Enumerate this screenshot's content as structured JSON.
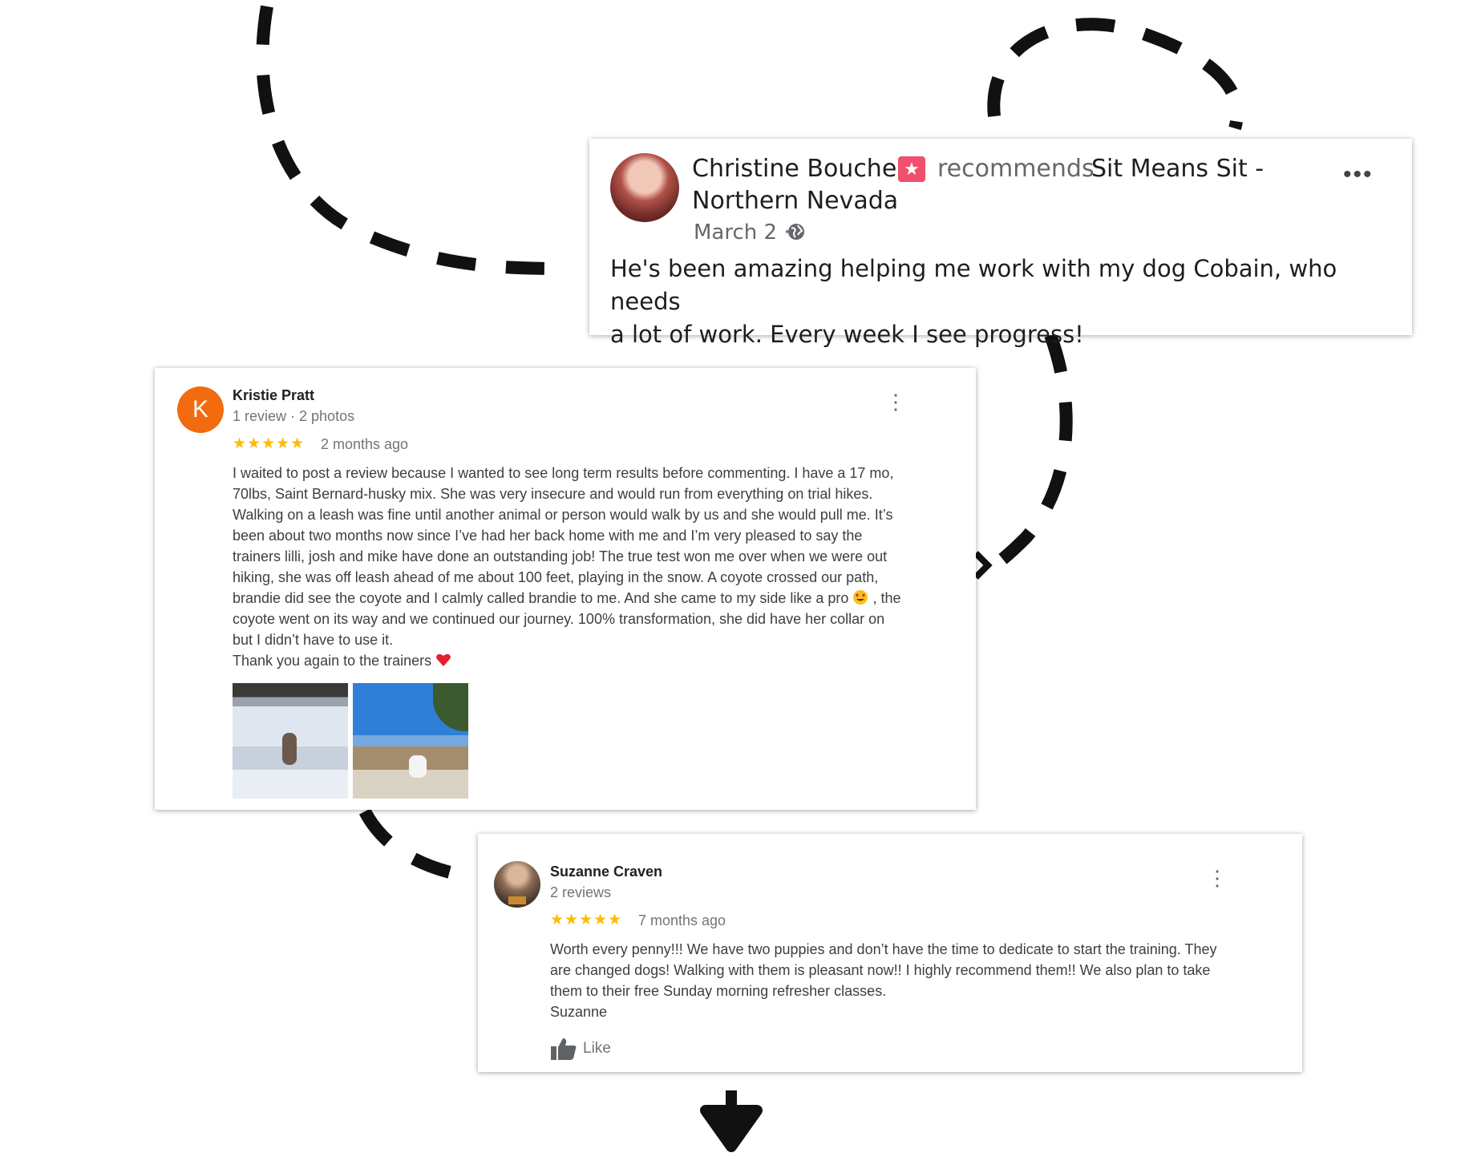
{
  "facebook_post": {
    "author": "Christine Boucher",
    "action": "recommends",
    "page_name_line1": "Sit Means Sit -",
    "page_name_line2": "Northern Nevada",
    "date": "March 2 ·",
    "text_line1": "He's been amazing helping me work with my dog Cobain, who needs",
    "text_line2": "a lot of work. Every week I see progress!",
    "more_label": "•••",
    "badge_glyph": "★"
  },
  "review_kristie": {
    "avatar_letter": "K",
    "name": "Kristie Pratt",
    "meta": "1 review · 2 photos",
    "stars": "★★★★★",
    "time_ago": "2 months ago",
    "lines": [
      "I waited to post a review because I wanted to see long term results before commenting. I have a 17 mo,",
      "70lbs, Saint Bernard-husky mix. She was very insecure and would run from everything on trial hikes.",
      "Walking on a leash was fine until another animal or person would walk by us and she would pull me. It’s",
      "been about two months now since I’ve had her back home with me and I’m very pleased to say the",
      "trainers lilli, josh and mike have done an outstanding job! The true test won me over when we were out",
      "hiking, she was off leash ahead of me about 100 feet, playing in the snow. A coyote crossed our path,"
    ],
    "line7_before": "brandie did see the coyote and I calmly called brandie to me. And she came to my side like a pro ",
    "line7_after": " , the",
    "line8": "coyote went on its way and we continued our journey. 100% transformation, she did have her collar on",
    "line9": "but I didn’t have to use it.",
    "line10": "Thank you again to the trainers ",
    "menu": "⋮"
  },
  "review_suzanne": {
    "name": "Suzanne Craven",
    "meta": "2 reviews",
    "stars": "★★★★★",
    "time_ago": "7 months ago",
    "lines": [
      "Worth every penny!!! We have two puppies and don’t have the time to dedicate to start the training. They",
      "are changed dogs! Walking with them is pleasant now!! I highly recommend them!! We also plan to take",
      "them to their free Sunday morning refresher classes.",
      "Suzanne"
    ],
    "like_label": "Like",
    "menu": "⋮"
  },
  "colors": {
    "star": "#fbbc04",
    "avatar_orange": "#f26b0f",
    "badge_pink": "#f0506e",
    "dash": "#111111"
  }
}
